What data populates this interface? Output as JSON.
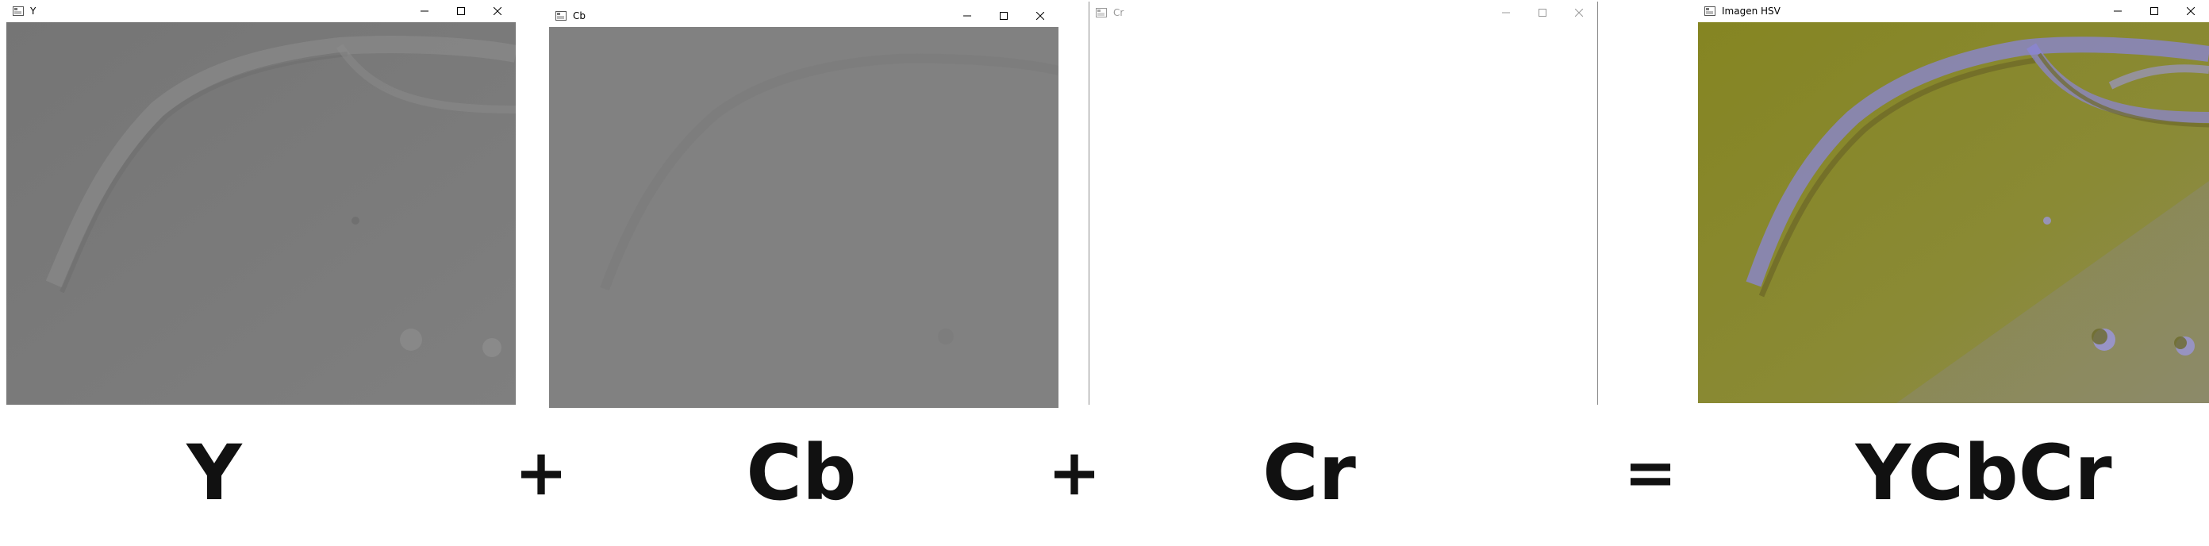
{
  "windows": [
    {
      "title": "Y",
      "state": "active"
    },
    {
      "title": "Cb",
      "state": "active"
    },
    {
      "title": "Cr",
      "state": "inactive"
    },
    {
      "title": "Imagen HSV",
      "state": "active"
    }
  ],
  "window_controls": [
    "minimize-icon",
    "maximize-icon",
    "close-icon"
  ],
  "equation": {
    "term1": "Y",
    "plus1": "+",
    "term2": "Cb",
    "plus2": "+",
    "term3": "Cr",
    "equals": "=",
    "result": "YCbCr"
  },
  "colors": {
    "y_channel": "#7d7d7d",
    "cb_channel": "#808080",
    "cr_channel": "#ffffff",
    "ycbcr_yellow": "#8a8a2a",
    "ycbcr_purple": "#8a85d8"
  }
}
